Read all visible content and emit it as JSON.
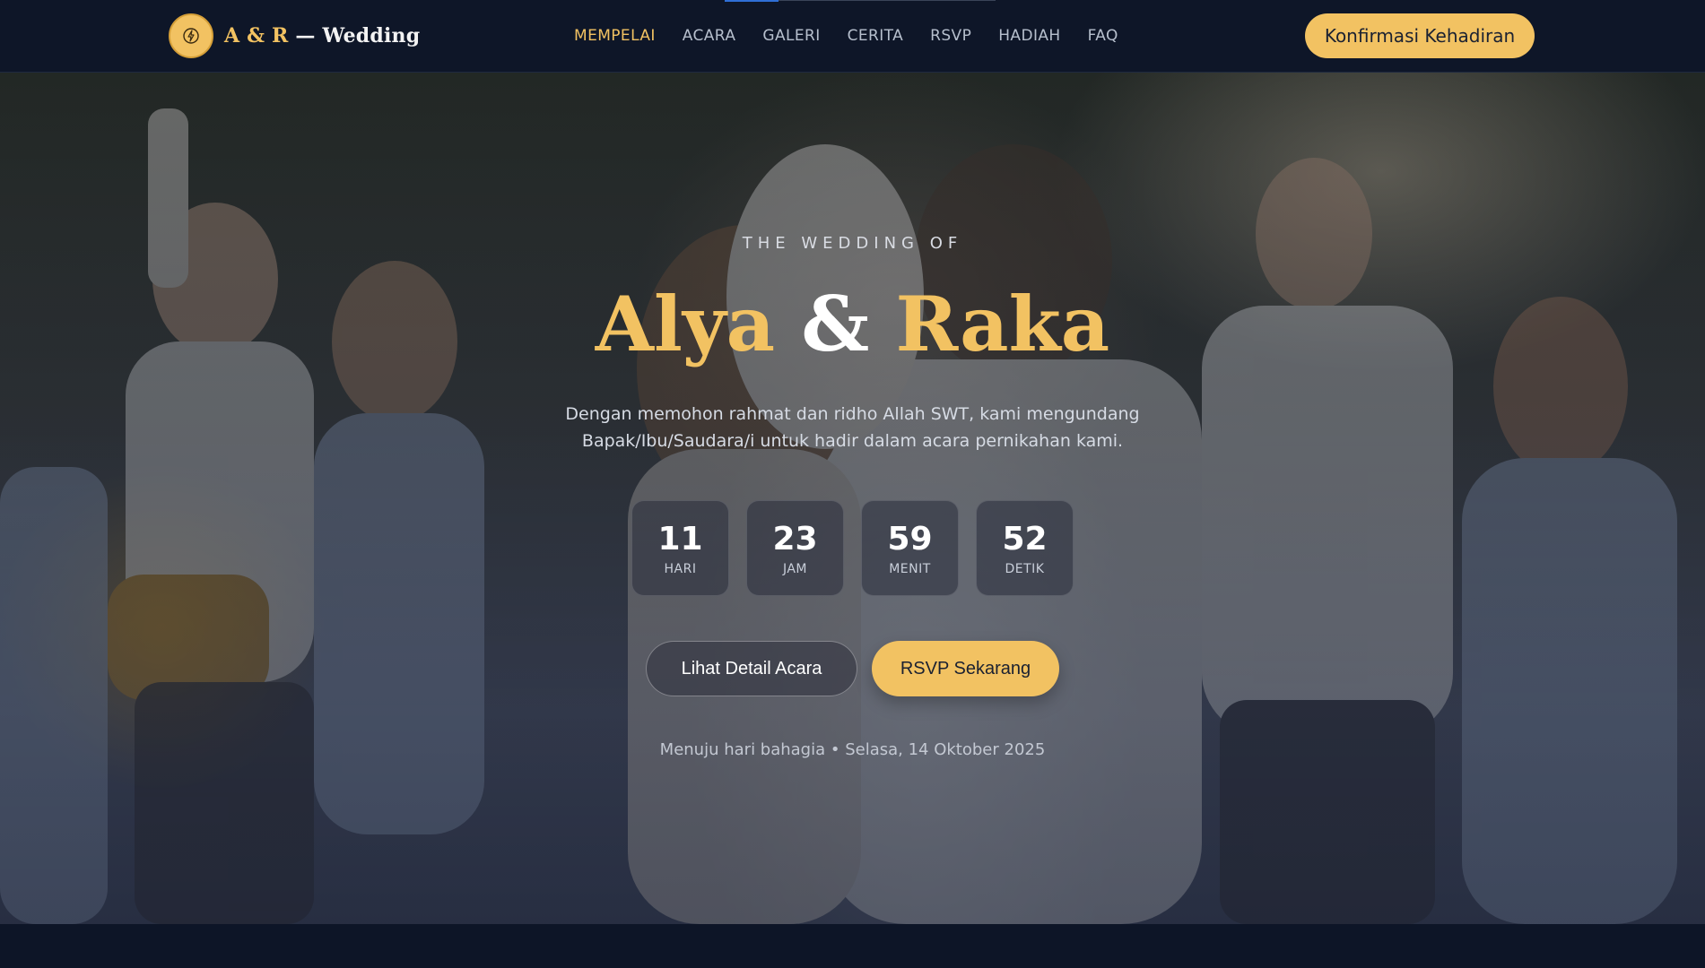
{
  "header": {
    "brand": {
      "initials": "A & R",
      "separator": " — ",
      "word": "Wedding",
      "icon": "seal-icon"
    },
    "nav": [
      {
        "label": "MEMPELAI",
        "active": true
      },
      {
        "label": "ACARA",
        "active": false
      },
      {
        "label": "GALERI",
        "active": false
      },
      {
        "label": "CERITA",
        "active": false
      },
      {
        "label": "RSVP",
        "active": false
      },
      {
        "label": "HADIAH",
        "active": false
      },
      {
        "label": "FAQ",
        "active": false
      }
    ],
    "cta_label": "Konfirmasi Kehadiran"
  },
  "hero": {
    "eyebrow": "THE WEDDING OF",
    "bride": "Alya",
    "ampersand": "&",
    "groom": "Raka",
    "intro": "Dengan memohon rahmat dan ridho Allah SWT, kami mengundang Bapak/Ibu/Saudara/i untuk hadir dalam acara pernikahan kami.",
    "countdown": [
      {
        "value": "11",
        "label": "HARI"
      },
      {
        "value": "23",
        "label": "JAM"
      },
      {
        "value": "59",
        "label": "MENIT"
      },
      {
        "value": "52",
        "label": "DETIK"
      }
    ],
    "buttons": {
      "detail": "Lihat Detail Acara",
      "rsvp": "RSVP Sekarang"
    },
    "footnote": "Menuju hari bahagia • Selasa, 14 Oktober 2025",
    "background_image": "wedding-couple-photo"
  },
  "colors": {
    "accent": "#f2c262",
    "navbar": "#0e1628",
    "page": "#0d1527",
    "text_muted": "#b6bfcd"
  }
}
